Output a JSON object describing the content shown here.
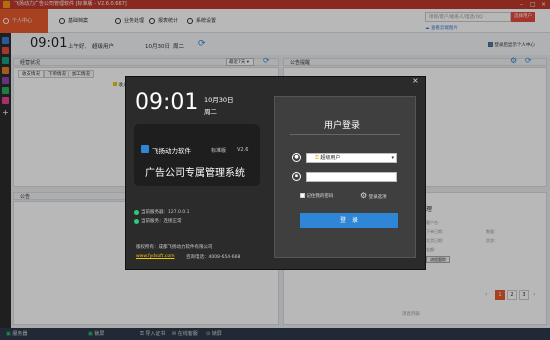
{
  "app": {
    "title": "飞扬动力广告公司管理软件 [标准版 - V2.6.0.667]"
  },
  "nav": {
    "tabs": [
      {
        "label": "个人中心"
      },
      {
        "label": "基础档案"
      },
      {
        "label": "业务处理"
      },
      {
        "label": "报表统计"
      },
      {
        "label": "系统设置"
      }
    ],
    "search_placeholder": "项目/客户/联系人/电话/QQ",
    "search_button": "选择用户",
    "cloud_link": "查看云端图片"
  },
  "status": {
    "time": "09:01",
    "greeting": "上午好,",
    "user": "超级用户",
    "date": "10月30日",
    "weekday": "周二",
    "auto_login_label": "登录后显示个人中心"
  },
  "left_panel": {
    "title": "经营状况",
    "filter": "最近7天",
    "subtabs": [
      "收支情况",
      "下单情况",
      "加工情况"
    ],
    "legend": "收入"
  },
  "right_panel": {
    "title": "公告提醒"
  },
  "bottom_left": {
    "title": "公告"
  },
  "bottom_right": {
    "title": "理",
    "labels": [
      "客户名:",
      "下单日期:",
      "交货日期:",
      "数量:",
      "状态:",
      "金额:"
    ],
    "view_button": "流程跟踪",
    "pager": [
      "1",
      "2",
      "3"
    ],
    "footer_note": "消息列表"
  },
  "statusbar": {
    "server": "服务器",
    "lock": "锁屏",
    "import": "导入证书",
    "online": "在线客服",
    "help": "锁屏"
  },
  "dialog": {
    "clock": "09:01",
    "date": "10月30日",
    "weekday": "周二",
    "brand": "飞扬动力软件",
    "edition": "标准版",
    "version": "V2.6",
    "product": "广告公司专属管理系统",
    "server_label": "当前服务器：127.0.0.1",
    "server_status": "当前服务：连接正常",
    "copyright": "版权所有：成都飞扬动力软件有限公司",
    "website": "www.fydsoft.com",
    "hotline": "咨询电话：4008-654-668",
    "login_title": "用户登录",
    "username": "超级用户",
    "password": "",
    "remember": "记住我的密码",
    "login_options": "登录选项",
    "login_button": "登　录",
    "close": "×"
  },
  "colors": {
    "accent": "#e85a2b",
    "title_bar": "#c0392b",
    "login_button": "#2f86d6",
    "dialog_bg": "#2b2b2b"
  }
}
